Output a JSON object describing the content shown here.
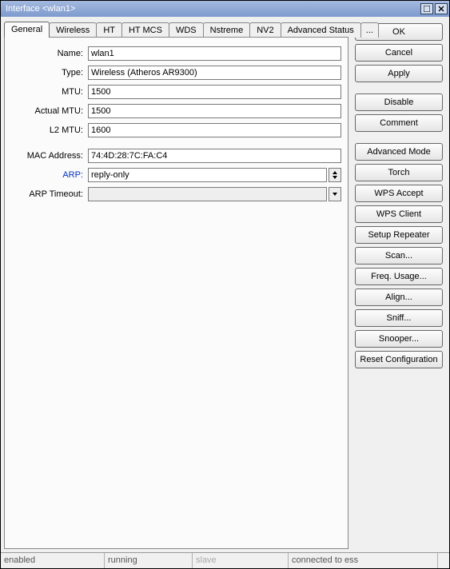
{
  "window": {
    "title": "Interface <wlan1>"
  },
  "tabs": {
    "items": [
      {
        "label": "General"
      },
      {
        "label": "Wireless"
      },
      {
        "label": "HT"
      },
      {
        "label": "HT MCS"
      },
      {
        "label": "WDS"
      },
      {
        "label": "Nstreme"
      },
      {
        "label": "NV2"
      },
      {
        "label": "Advanced Status"
      },
      {
        "label": "..."
      }
    ],
    "active_index": 0
  },
  "form": {
    "name": {
      "label": "Name:",
      "value": "wlan1"
    },
    "type": {
      "label": "Type:",
      "value": "Wireless (Atheros AR9300)"
    },
    "mtu": {
      "label": "MTU:",
      "value": "1500"
    },
    "actual_mtu": {
      "label": "Actual MTU:",
      "value": "1500"
    },
    "l2_mtu": {
      "label": "L2 MTU:",
      "value": "1600"
    },
    "mac": {
      "label": "MAC Address:",
      "value": "74:4D:28:7C:FA:C4"
    },
    "arp": {
      "label": "ARP:",
      "value": "reply-only"
    },
    "arp_timeout": {
      "label": "ARP Timeout:",
      "value": ""
    }
  },
  "buttons": {
    "ok": "OK",
    "cancel": "Cancel",
    "apply": "Apply",
    "disable": "Disable",
    "comment": "Comment",
    "advanced_mode": "Advanced Mode",
    "torch": "Torch",
    "wps_accept": "WPS Accept",
    "wps_client": "WPS Client",
    "setup_repeater": "Setup Repeater",
    "scan": "Scan...",
    "freq_usage": "Freq. Usage...",
    "align": "Align...",
    "sniff": "Sniff...",
    "snooper": "Snooper...",
    "reset_config": "Reset Configuration"
  },
  "status": {
    "enabled": "enabled",
    "running": "running",
    "slave": "slave",
    "conn": "connected to ess"
  }
}
